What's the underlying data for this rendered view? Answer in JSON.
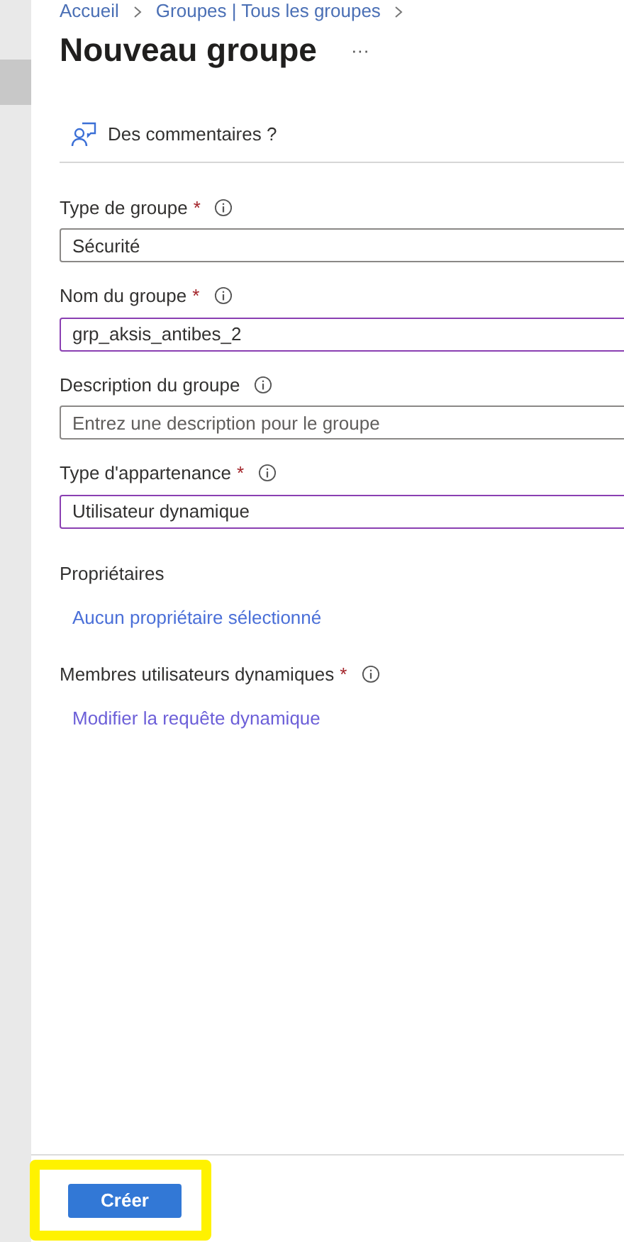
{
  "breadcrumb": [
    "Accueil",
    "Groupes | Tous les groupes"
  ],
  "title": "Nouveau groupe",
  "more": "···",
  "feedback": "Des commentaires ?",
  "fields": [
    {
      "label": "Type de groupe",
      "required_mark": "*",
      "value": "Sécurité",
      "focused": false
    },
    {
      "label": "Nom du groupe",
      "required_mark": "*",
      "value": "grp_aksis_antibes_2",
      "focused": true
    },
    {
      "label": "Description du groupe",
      "placeholder": "Entrez une description pour le groupe",
      "focused": false
    },
    {
      "label": "Type d'appartenance",
      "required_mark": "*",
      "value": "Utilisateur dynamique",
      "focused": true
    }
  ],
  "owners": {
    "label": "Propriétaires",
    "link": "Aucun propriétaire sélectionné"
  },
  "members": {
    "label": "Membres utilisateurs dynamiques",
    "required_mark": "*",
    "link": "Modifier la requête dynamique"
  },
  "create_button": {
    "label": "Créer",
    "highlighted": true
  }
}
